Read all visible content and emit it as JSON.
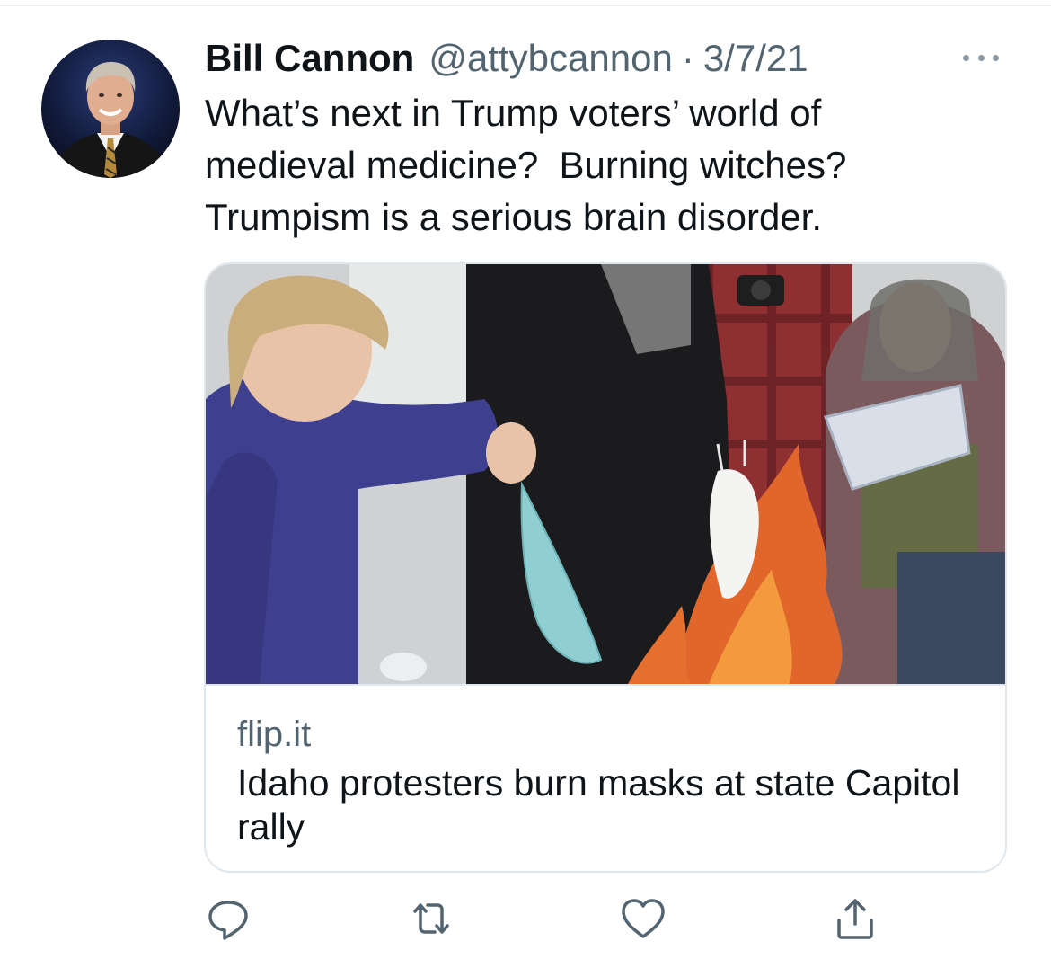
{
  "tweet": {
    "author_name": "Bill Cannon",
    "handle": "@attybcannon",
    "separator": "·",
    "date": "3/7/21",
    "text": "What’s next in Trump voters’ world of\nmedieval medicine?  Burning witches?\nTrumpism is a serious brain disorder."
  },
  "card": {
    "domain": "flip.it",
    "title": "Idaho protesters burn masks at state Capitol rally"
  },
  "icons": {
    "more": "more-options-icon",
    "reply": "reply-icon",
    "retweet": "retweet-icon",
    "like": "like-icon",
    "share": "share-icon"
  },
  "colors": {
    "text_primary": "#0f1419",
    "text_secondary": "#536471",
    "icon_gray": "#536471",
    "border": "#e1e8ed"
  }
}
